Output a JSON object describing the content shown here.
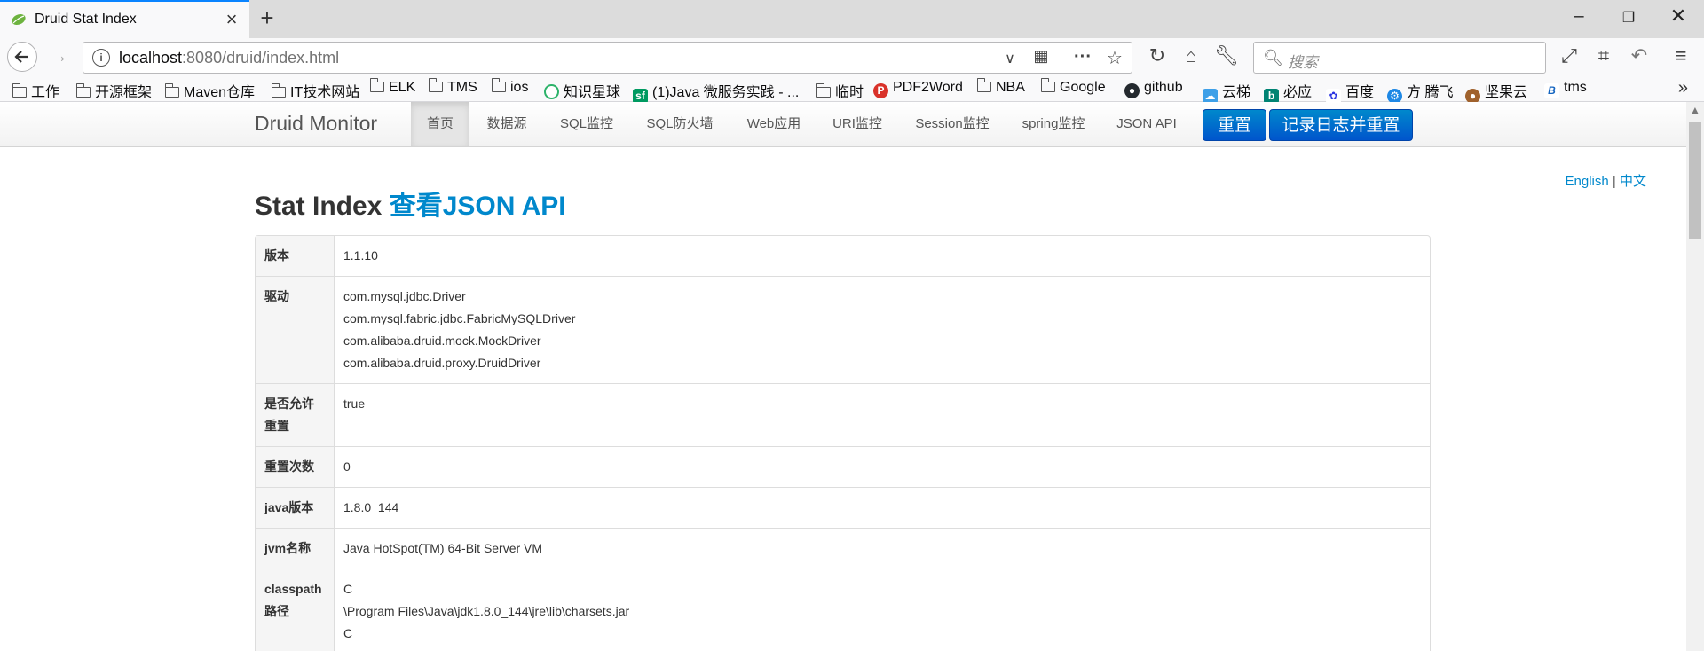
{
  "browser": {
    "tab_title": "Druid Stat Index",
    "url_host": "localhost",
    "url_path": ":8080/druid/index.html",
    "search_placeholder": "搜索",
    "bookmarks": [
      "工作",
      "开源框架",
      "Maven仓库",
      "IT技术网站",
      "ELK",
      "TMS",
      "ios",
      "知识星球",
      "(1)Java 微服务实践 - ...",
      "临时",
      "PDF2Word",
      "NBA",
      "Google",
      "github",
      "云梯",
      "必应",
      "百度",
      "方 腾飞",
      "坚果云",
      "tms"
    ]
  },
  "nav": {
    "brand": "Druid Monitor",
    "items": [
      "首页",
      "数据源",
      "SQL监控",
      "SQL防火墙",
      "Web应用",
      "URI监控",
      "Session监控",
      "spring监控",
      "JSON API"
    ],
    "reset_button": "重置",
    "log_reset_button": "记录日志并重置"
  },
  "lang": {
    "english": "English",
    "sep": "|",
    "chinese": "中文"
  },
  "heading": {
    "title": "Stat Index",
    "link": "查看JSON API"
  },
  "rows": [
    {
      "key": "版本",
      "values": [
        "1.1.10"
      ]
    },
    {
      "key": "驱动",
      "values": [
        "com.mysql.jdbc.Driver",
        "com.mysql.fabric.jdbc.FabricMySQLDriver",
        "com.alibaba.druid.mock.MockDriver",
        "com.alibaba.druid.proxy.DruidDriver"
      ]
    },
    {
      "key": "是否允许重置",
      "values": [
        "true"
      ]
    },
    {
      "key": "重置次数",
      "values": [
        "0"
      ]
    },
    {
      "key": "java版本",
      "values": [
        "1.8.0_144"
      ]
    },
    {
      "key": "jvm名称",
      "values": [
        "Java HotSpot(TM) 64-Bit Server VM"
      ]
    },
    {
      "key": "classpath路径",
      "values": [
        "C",
        "\\Program Files\\Java\\jdk1.8.0_144\\jre\\lib\\charsets.jar",
        "C"
      ]
    }
  ],
  "colors": {
    "accent": "#0088cc",
    "button": "#0066cc",
    "tab_highlight": "#0a84ff"
  }
}
